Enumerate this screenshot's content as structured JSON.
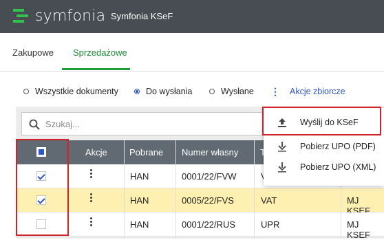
{
  "topbar": {
    "brand": "symfonia",
    "app_name": "Symfonia KSeF"
  },
  "tabs": [
    {
      "label": "Zakupowe"
    },
    {
      "label": "Sprzedażowe",
      "active": true
    }
  ],
  "filters": {
    "options": [
      {
        "label": "Wszystkie dokumenty",
        "selected": false
      },
      {
        "label": "Do wysłania",
        "selected": true
      },
      {
        "label": "Wysłane",
        "selected": false
      }
    ],
    "bulk_actions_label": "Akcje zbiorcze"
  },
  "search": {
    "placeholder": "Szukaj..."
  },
  "table": {
    "columns": [
      "Akcje",
      "Pobrane",
      "Numer własny",
      "T"
    ],
    "rows": [
      {
        "checked": true,
        "pobrane": "HAN",
        "numer": "0001/22/FVW",
        "typ": "V",
        "firma": ""
      },
      {
        "checked": true,
        "pobrane": "HAN",
        "numer": "0005/22/FVS",
        "typ": "VAT",
        "firma": "MJ KSEF",
        "highlight": true
      },
      {
        "checked": false,
        "pobrane": "HAN",
        "numer": "0001/22/RUS",
        "typ": "UPR",
        "firma": "MJ KSEF"
      }
    ]
  },
  "menu": {
    "items": [
      {
        "label": "Wyślij do KSeF",
        "icon": "upload-icon"
      },
      {
        "label": "Pobierz UPO (PDF)",
        "icon": "download-icon"
      },
      {
        "label": "Pobierz UPO (XML)",
        "icon": "download-icon"
      }
    ]
  },
  "colors": {
    "topbar": "#474d52",
    "accent_green": "#1f9b3a",
    "link_blue": "#2c55c6",
    "highlight_red": "#d42027",
    "row_highlight": "#fdf0b0"
  }
}
